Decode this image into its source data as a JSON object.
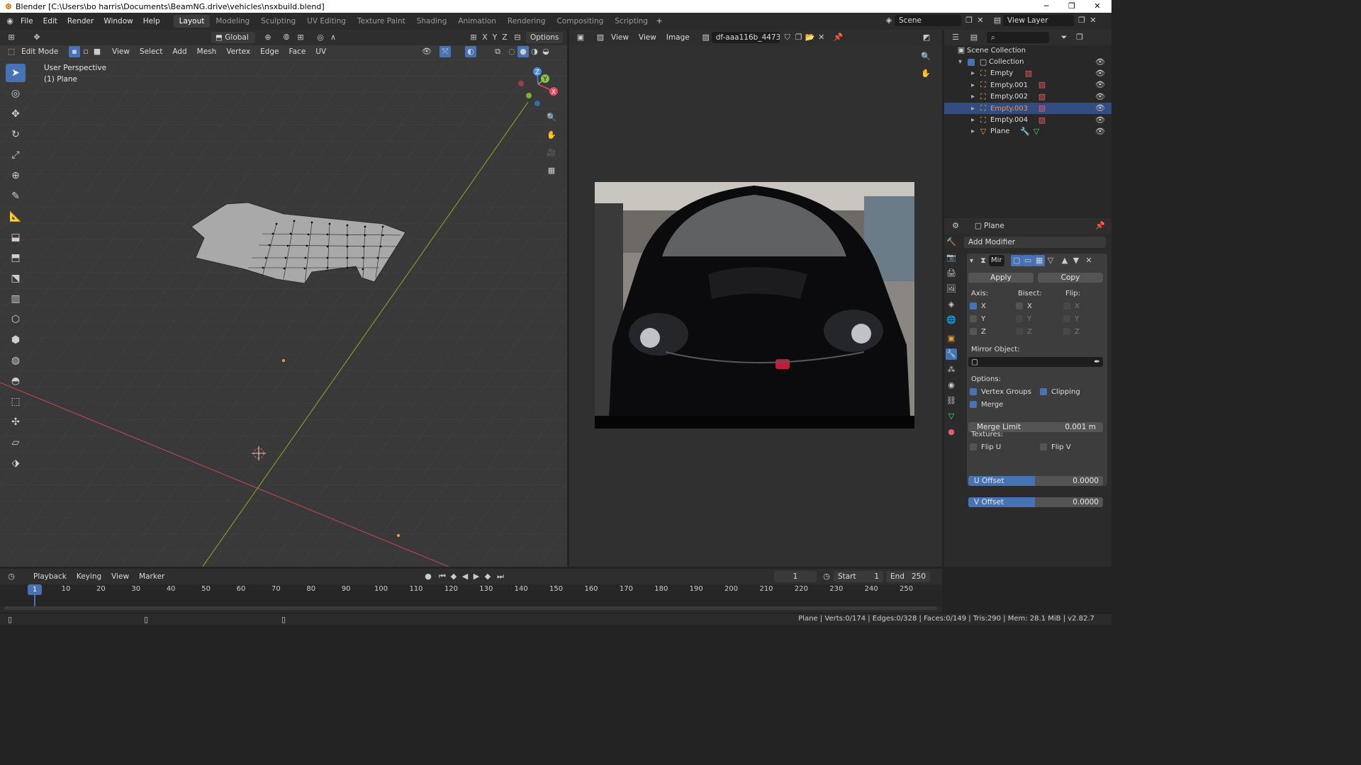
{
  "window": {
    "title": "Blender [C:\\Users\\bo harris\\Documents\\BeamNG.drive\\vehicles\\nsxbuild.blend]"
  },
  "menu": {
    "items": [
      "File",
      "Edit",
      "Render",
      "Window",
      "Help"
    ]
  },
  "workspaces": [
    {
      "label": "Layout",
      "active": true
    },
    {
      "label": "Modeling"
    },
    {
      "label": "Sculpting"
    },
    {
      "label": "UV Editing"
    },
    {
      "label": "Texture Paint"
    },
    {
      "label": "Shading"
    },
    {
      "label": "Animation"
    },
    {
      "label": "Rendering"
    },
    {
      "label": "Compositing"
    },
    {
      "label": "Scripting"
    }
  ],
  "scene": {
    "label": "Scene",
    "view_layer": "View Layer"
  },
  "viewport": {
    "mode": "Edit Mode",
    "menus": [
      "View",
      "Select",
      "Add",
      "Mesh",
      "Vertex",
      "Edge",
      "Face",
      "UV"
    ],
    "orientation": "Global",
    "options_label": "Options",
    "axes": [
      "X",
      "Y",
      "Z"
    ],
    "info_line1": "User Perspective",
    "info_line2": "(1) Plane",
    "gizmo": {
      "x": "X",
      "y": "Y",
      "z": "Z"
    }
  },
  "image_editor": {
    "menus": [
      "View",
      "View",
      "Image"
    ],
    "image_name": "df-aaa116b_4473..."
  },
  "outliner": {
    "root": "Scene Collection",
    "collection": "Collection",
    "items": [
      {
        "name": "Empty",
        "selected": false
      },
      {
        "name": "Empty.001",
        "selected": false
      },
      {
        "name": "Empty.002",
        "selected": false
      },
      {
        "name": "Empty.003",
        "selected": true
      },
      {
        "name": "Empty.004",
        "selected": false
      },
      {
        "name": "Plane",
        "selected": false
      }
    ]
  },
  "properties": {
    "object": "Plane",
    "add_modifier": "Add Modifier",
    "modifier_name": "Mir",
    "apply": "Apply",
    "copy": "Copy",
    "axis_label": "Axis:",
    "bisect_label": "Bisect:",
    "flip_label": "Flip:",
    "axis": {
      "X": true,
      "Y": false,
      "Z": false
    },
    "bisect": {
      "X": false,
      "Y": false,
      "Z": false
    },
    "flip": {
      "X": false,
      "Y": false,
      "Z": false
    },
    "mirror_object_label": "Mirror Object:",
    "options_label": "Options:",
    "vertex_groups": "Vertex Groups",
    "clipping": "Clipping",
    "merge": "Merge",
    "merge_limit_label": "Merge Limit",
    "merge_limit_value": "0.001 m",
    "textures_label": "Textures:",
    "flip_u": "Flip U",
    "flip_v": "Flip V",
    "u_offset_label": "U Offset",
    "u_offset_value": "0.0000",
    "v_offset_label": "V Offset",
    "v_offset_value": "0.0000"
  },
  "timeline": {
    "menus": [
      "Playback",
      "Keying",
      "View",
      "Marker"
    ],
    "current_frame": "1",
    "start_label": "Start",
    "start": "1",
    "end_label": "End",
    "end": "250",
    "ticks": [
      "10",
      "20",
      "30",
      "40",
      "50",
      "60",
      "70",
      "80",
      "90",
      "100",
      "110",
      "120",
      "130",
      "140",
      "150",
      "160",
      "170",
      "180",
      "190",
      "200",
      "210",
      "220",
      "230",
      "240",
      "250"
    ],
    "playhead": "1"
  },
  "status": {
    "text": "Plane | Verts:0/174 | Edges:0/328 | Faces:0/149 | Tris:290 | Mem: 28.1 MiB | v2.82.7"
  },
  "colors": {
    "accent": "#4772b3",
    "selected_row": "#334d80",
    "selected_text": "#ff8c3c",
    "x_axis": "#e84a5f",
    "y_axis": "#8bc34a",
    "z_axis": "#4b8cd8"
  }
}
